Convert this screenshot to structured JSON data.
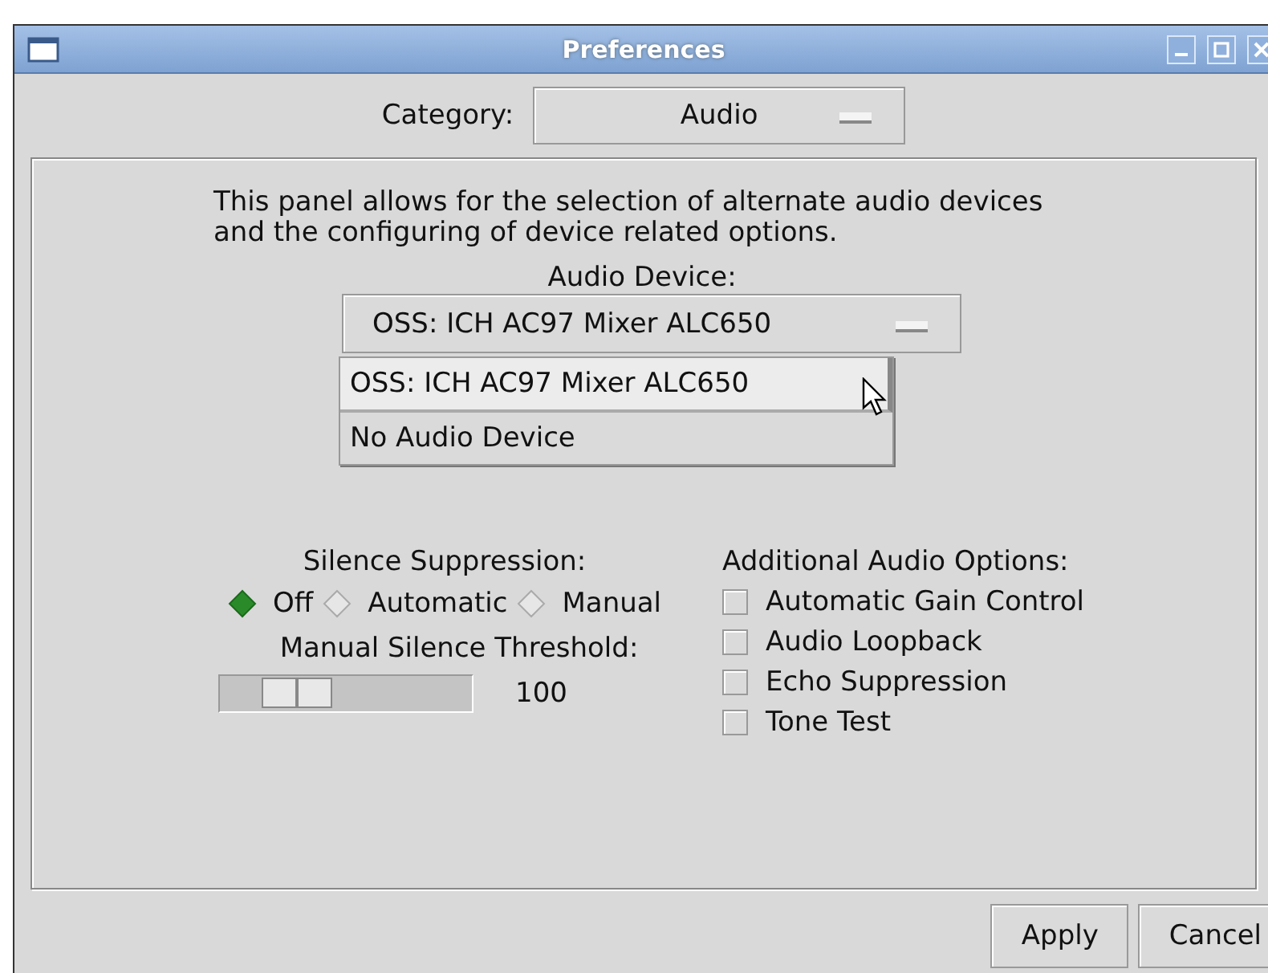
{
  "window": {
    "title": "Preferences"
  },
  "category": {
    "label": "Category:",
    "value": "Audio"
  },
  "panel": {
    "description": "This panel allows for the selection of alternate audio devices\nand the configuring of device related options.",
    "audio_device": {
      "label": "Audio Device:",
      "value": "OSS: ICH AC97 Mixer ALC650",
      "menu": [
        {
          "label": "OSS: ICH AC97 Mixer ALC650",
          "selected": true
        },
        {
          "label": "No Audio Device",
          "selected": false
        }
      ]
    },
    "silence": {
      "label": "Silence Suppression:",
      "options": [
        {
          "label": "Off",
          "selected": true
        },
        {
          "label": "Automatic",
          "selected": false
        },
        {
          "label": "Manual",
          "selected": false
        }
      ],
      "threshold_label": "Manual Silence Threshold:",
      "threshold": {
        "level": 0.23,
        "reading": "100"
      }
    },
    "additional": {
      "label": "Additional Audio Options:",
      "options": [
        {
          "label": "Automatic Gain Control",
          "checked": false
        },
        {
          "label": "Audio Loopback",
          "checked": false
        },
        {
          "label": "Echo Suppression",
          "checked": false
        },
        {
          "label": "Tone Test",
          "checked": false
        }
      ]
    }
  },
  "buttons": [
    "Apply",
    "Cancel"
  ]
}
